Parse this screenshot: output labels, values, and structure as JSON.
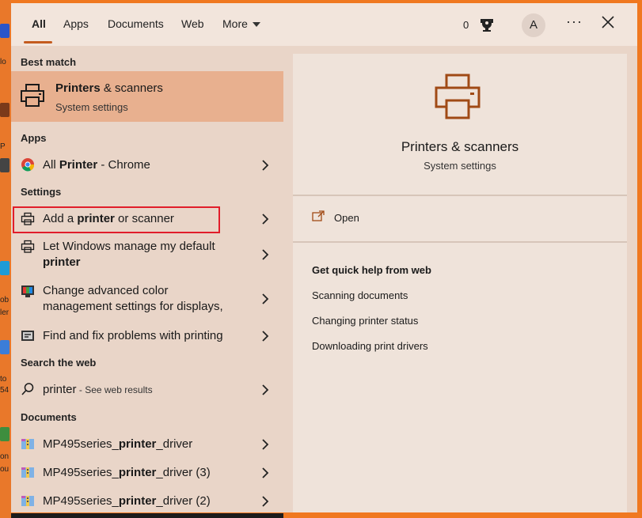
{
  "tabs": [
    "All",
    "Apps",
    "Documents",
    "Web",
    "More"
  ],
  "header": {
    "reward_count": "0",
    "avatar_letter": "A",
    "more_label": "···"
  },
  "best_match": {
    "heading": "Best match",
    "title_bold": "Printers",
    "title_rest": " & scanners",
    "subtitle": "System settings"
  },
  "apps": {
    "heading": "Apps",
    "items": [
      {
        "pre": "All ",
        "bold": "Printer",
        "post": " - Chrome"
      }
    ]
  },
  "settings": {
    "heading": "Settings",
    "items": [
      {
        "pre": "Add a ",
        "bold": "printer",
        "post": " or scanner"
      },
      {
        "pre": "Let Windows manage my default ",
        "bold": "printer",
        "post": ""
      },
      {
        "pre": "Change advanced color management settings for displays,",
        "bold": "",
        "post": ""
      },
      {
        "pre": "Find and fix problems with printing",
        "bold": "",
        "post": ""
      }
    ]
  },
  "web": {
    "heading": "Search the web",
    "query": "printer",
    "suffix": " - See web results"
  },
  "documents": {
    "heading": "Documents",
    "items": [
      {
        "pre": "MP495series_",
        "bold": "printer",
        "post": "_driver"
      },
      {
        "pre": "MP495series_",
        "bold": "printer",
        "post": "_driver (3)"
      },
      {
        "pre": "MP495series_",
        "bold": "printer",
        "post": "_driver (2)"
      }
    ]
  },
  "preview": {
    "title": "Printers & scanners",
    "subtitle": "System settings",
    "open_label": "Open",
    "help_heading": "Get quick help from web",
    "help_links": [
      "Scanning documents",
      "Changing printer status",
      "Downloading print drivers"
    ]
  },
  "desktop_fragments": [
    "lo",
    "P",
    "ob",
    "ler",
    "to",
    "54",
    "on",
    "ou"
  ],
  "colors": {
    "accent": "#c45b1e",
    "highlight_border": "#e11d2a",
    "best_match_bg": "#e8b08f"
  }
}
